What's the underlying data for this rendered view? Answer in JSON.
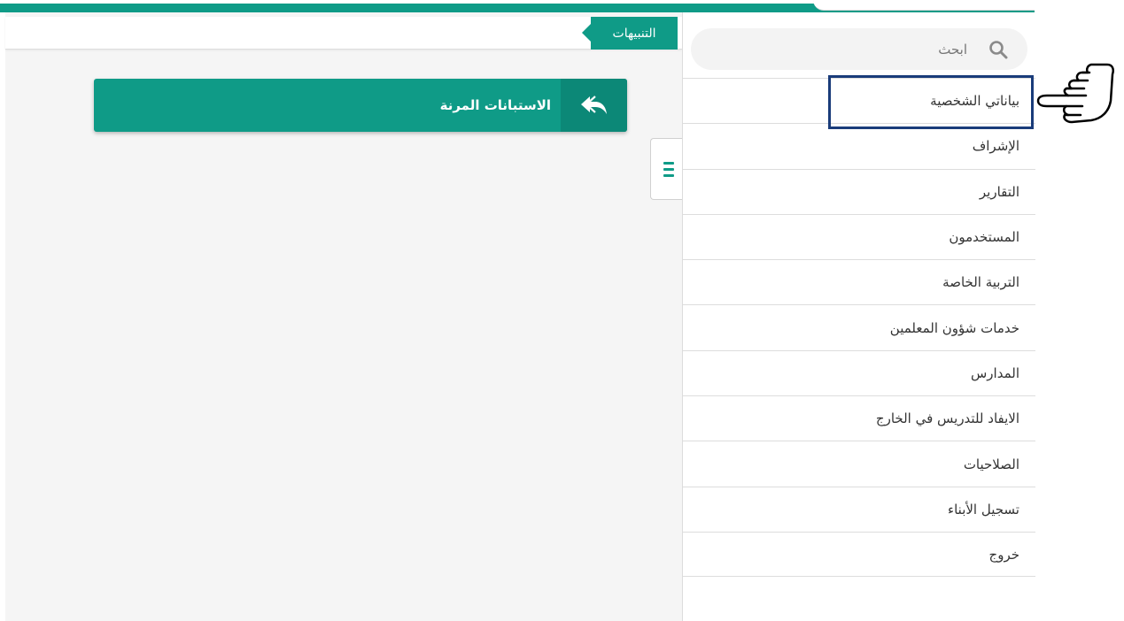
{
  "alerts_tab": {
    "label": "التنبيهات"
  },
  "form_card": {
    "title": "الاستبانات المرنة",
    "icon": "reply-arrow-icon"
  },
  "search": {
    "placeholder": "ابحث",
    "icon": "search-icon"
  },
  "sidebar": {
    "items": [
      {
        "label": "بياناتي الشخصية",
        "highlighted": true
      },
      {
        "label": "الإشراف"
      },
      {
        "label": "التقارير"
      },
      {
        "label": "المستخدمون"
      },
      {
        "label": "التربية الخاصة"
      },
      {
        "label": "خدمات شؤون المعلمين"
      },
      {
        "label": "المدارس"
      },
      {
        "label": "الايفاد للتدريس في الخارج"
      },
      {
        "label": "الصلاحيات"
      },
      {
        "label": "تسجيل الأبناء"
      },
      {
        "label": "خروج"
      }
    ]
  },
  "colors": {
    "accent": "#0f9b87",
    "accent_dark": "#0c8877",
    "highlight_border": "#1a3c7a"
  }
}
